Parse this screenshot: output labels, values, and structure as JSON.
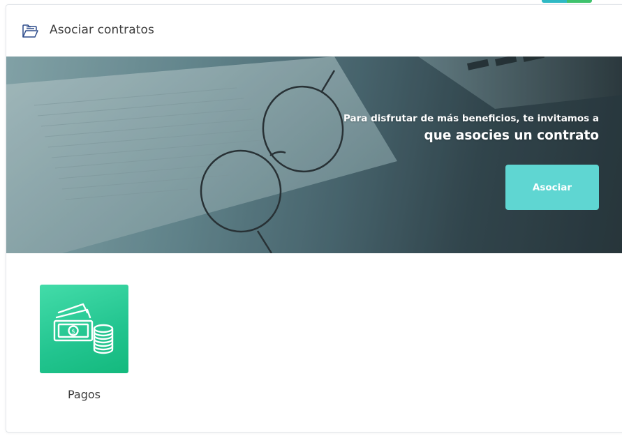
{
  "header": {
    "title": "Asociar contratos",
    "icon": "folder-open-icon"
  },
  "banner": {
    "line1": "Para disfrutar de más beneficios, te invitamos a",
    "line2": "que asocies un contrato",
    "button_label": "Asociar",
    "button_color": "#5fd6d2",
    "image": "documents-glasses-laptop-photo"
  },
  "tiles": [
    {
      "label": "Pagos",
      "icon": "money-coins-icon",
      "color": "#22c48f"
    }
  ]
}
